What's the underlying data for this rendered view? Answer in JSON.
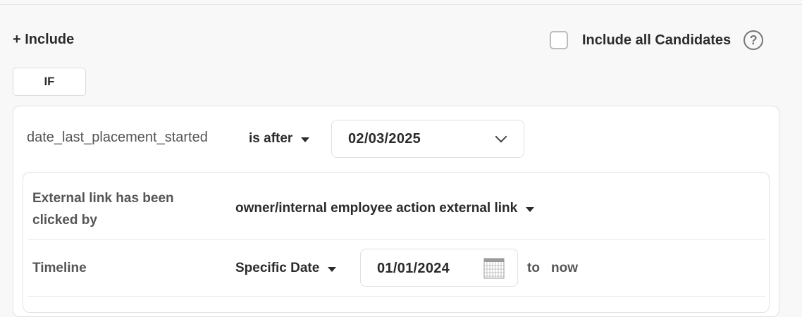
{
  "header": {
    "include_label": "+ Include",
    "include_all_label": "Include all Candidates",
    "include_all_checked": false,
    "help_icon": "question-circle-icon",
    "help_glyph": "?"
  },
  "condition": {
    "if_label": "IF",
    "field": "date_last_placement_started",
    "operator": "is after",
    "value": "02/03/2025"
  },
  "nested": {
    "external_link": {
      "label": "External link has been clicked by",
      "value": "owner/internal employee action external link"
    },
    "timeline": {
      "label": "Timeline",
      "type": "Specific Date",
      "from_date": "01/01/2024",
      "to_label": "to",
      "end": "now"
    }
  }
}
